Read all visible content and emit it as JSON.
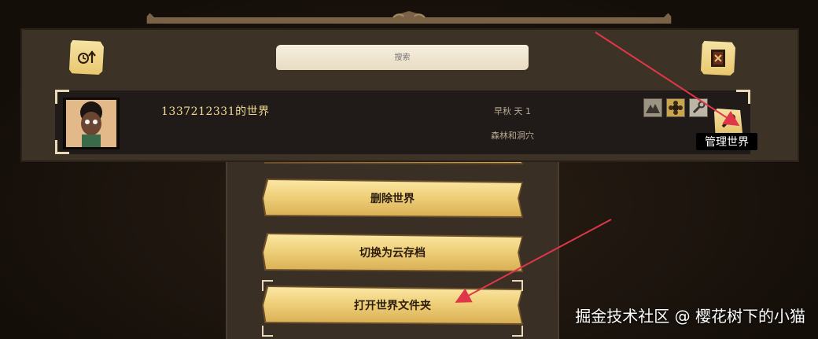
{
  "search": {
    "placeholder": "搜索"
  },
  "world": {
    "name": "1337212331的世界",
    "season": "早秋 天 1",
    "type": "森林和洞穴"
  },
  "tooltip": {
    "manage_world": "管理世界"
  },
  "menu": {
    "delete_world": "删除世界",
    "switch_cloud": "切换为云存档",
    "open_folder": "打开世界文件夹"
  },
  "watermark": {
    "text": "掘金技术社区 @ 樱花树下的小猫"
  },
  "icons": {
    "sort": "sort-time-icon",
    "filter": "character-filter-icon",
    "mod1": "mountain-icon",
    "mod2": "flower-icon",
    "mod3": "wrench-icon",
    "manage": "wrench-icon"
  },
  "colors": {
    "gold": "#efd07a",
    "panel": "#3d3226",
    "row": "#201b18",
    "arrow": "#e0364a"
  }
}
